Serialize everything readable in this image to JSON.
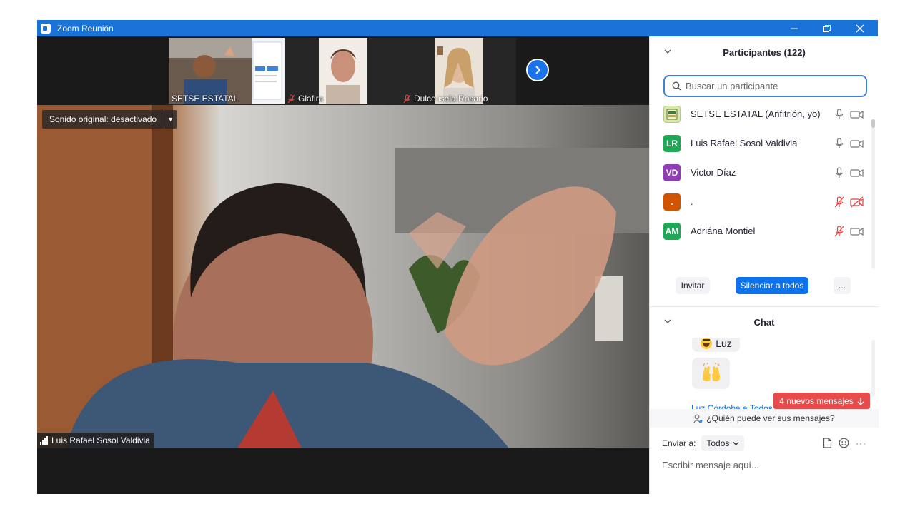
{
  "window": {
    "title": "Zoom Reunión"
  },
  "thumbnails": [
    {
      "name": "SETSE ESTATAL",
      "muted": false
    },
    {
      "name": "Glafira",
      "muted": true
    },
    {
      "name": "Dulce isela Rosado",
      "muted": true
    }
  ],
  "main_video": {
    "original_sound": "Sonido original: desactivado",
    "speaker": "Luis Rafael Sosol  Valdivia"
  },
  "participants": {
    "header": "Participantes (122)",
    "search_placeholder": "Buscar un participante",
    "list": [
      {
        "initials": "",
        "name": "SETSE ESTATAL (Anfitrión, yo)",
        "color": "#d8e9b0",
        "mic_muted": false,
        "cam_off": false
      },
      {
        "initials": "LR",
        "name": "Luis Rafael Sosol  Valdivia",
        "color": "#1fa855",
        "mic_muted": false,
        "cam_off": false
      },
      {
        "initials": "VD",
        "name": "Victor Díaz",
        "color": "#8f3fb3",
        "mic_muted": false,
        "cam_off": false
      },
      {
        "initials": ".",
        "name": ".",
        "color": "#d35400",
        "mic_muted": true,
        "cam_off": true
      },
      {
        "initials": "AM",
        "name": "Adriána Montiel",
        "color": "#1fa855",
        "mic_muted": true,
        "cam_off": false
      }
    ],
    "invite": "Invitar",
    "mute_all": "Silenciar a todos",
    "more": "..."
  },
  "chat": {
    "header": "Chat",
    "messages": [
      {
        "text": "Luz"
      }
    ],
    "partial_sender": "Luz Córdoba a Todos",
    "new_messages": "4 nuevos mensajes",
    "who_can_see": "¿Quién puede ver sus mensajes?",
    "send_to_label": "Enviar a:",
    "send_to_value": "Todos",
    "input_placeholder": "Escribir mensaje aquí...",
    "more_tools": "···"
  },
  "colors": {
    "titlebar": "#1a73d9",
    "primary_button": "#0e72ed",
    "new_messages_badge": "#e74c4c",
    "muted_icon": "#e03c3c"
  }
}
